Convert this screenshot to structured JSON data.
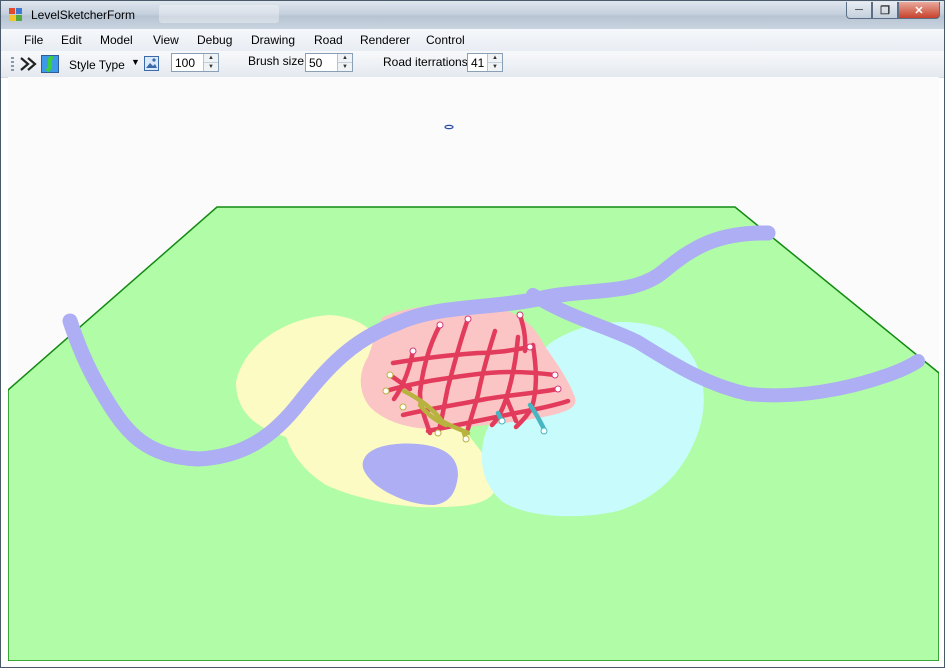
{
  "window": {
    "title": "LevelSketcherForm"
  },
  "menu": {
    "items": [
      "File",
      "Edit",
      "Model",
      "View",
      "Debug",
      "Drawing",
      "Road",
      "Renderer",
      "Control"
    ]
  },
  "toolbar": {
    "style_type_label": "Style Type",
    "size_value": "100",
    "brush_size_label": "Brush size",
    "brush_size_value": "50",
    "road_iterations_label": "Road iterrations",
    "road_iterations_value": "41"
  },
  "colors": {
    "ground": "#b1fca6",
    "ground_edge": "#128a12",
    "river": "#adaef4",
    "yellow_zone": "#fcfbc3",
    "pink_zone": "#fbc5c5",
    "cyan_zone": "#c8fcfc",
    "road": "#e33b5b",
    "road_green": "#b8b33e",
    "road_cyan": "#46b6c0"
  }
}
